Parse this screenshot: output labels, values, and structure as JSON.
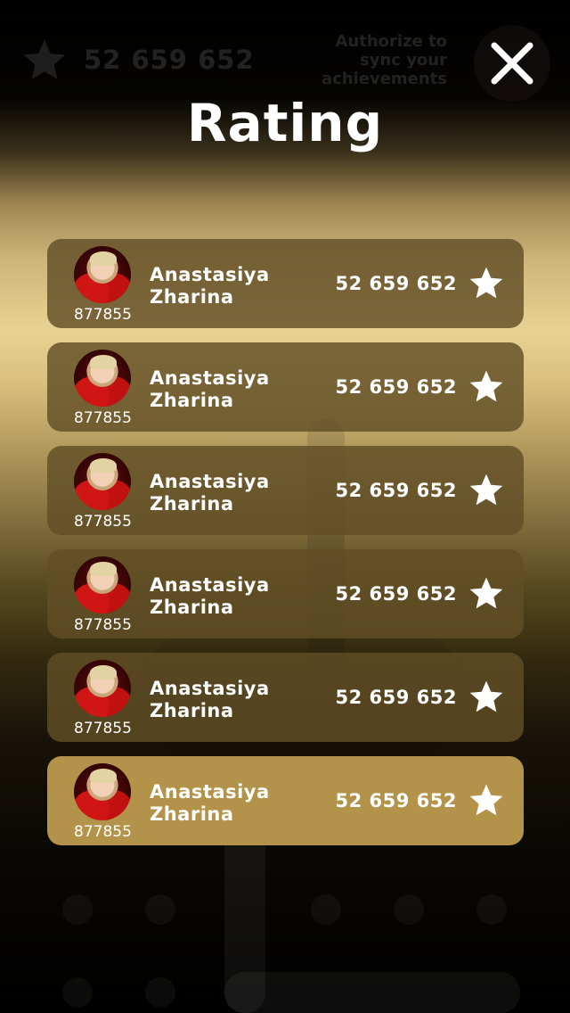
{
  "header": {
    "score": "52 659 652",
    "auth_text": "Authorize to sync your achievements",
    "star_icon": "star-icon",
    "close_icon": "close-icon"
  },
  "title": "Rating",
  "colors": {
    "row_bg": "#624e26",
    "row_highlight_bg": "#b39349",
    "text": "#ffffff"
  },
  "rows": [
    {
      "name": "Anastasiya Zharina",
      "id": "877855",
      "score": "52 659 652",
      "highlight": false
    },
    {
      "name": "Anastasiya Zharina",
      "id": "877855",
      "score": "52 659 652",
      "highlight": false
    },
    {
      "name": "Anastasiya Zharina",
      "id": "877855",
      "score": "52 659 652",
      "highlight": false
    },
    {
      "name": "Anastasiya Zharina",
      "id": "877855",
      "score": "52 659 652",
      "highlight": false
    },
    {
      "name": "Anastasiya Zharina",
      "id": "877855",
      "score": "52 659 652",
      "highlight": false
    },
    {
      "name": "Anastasiya Zharina",
      "id": "877855",
      "score": "52 659 652",
      "highlight": true
    }
  ]
}
